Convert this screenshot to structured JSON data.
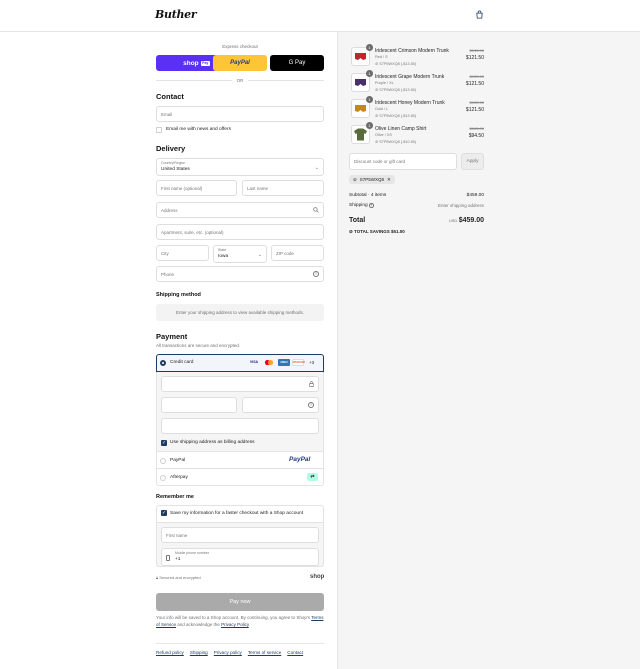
{
  "brand": {
    "logo": "Buther"
  },
  "express": {
    "title": "Express checkout",
    "or": "OR",
    "shop_pay": "shop",
    "shop_pay_tag": "Pay",
    "paypal": "PayPal",
    "gpay": "G Pay"
  },
  "contact": {
    "title": "Contact",
    "email_placeholder": "Email",
    "news_label": "Email me with news and offers"
  },
  "delivery": {
    "title": "Delivery",
    "country_label": "Country/Region",
    "country_value": "United States",
    "first_name": "First name (optional)",
    "last_name": "Last name",
    "address": "Address",
    "apartment": "Apartment, suite, etc. (optional)",
    "city": "City",
    "state_label": "State",
    "state_value": "Iowa",
    "zip": "ZIP code",
    "phone": "Phone"
  },
  "shipping": {
    "title": "Shipping method",
    "notice": "Enter your shipping address to view available shipping methods."
  },
  "payment": {
    "title": "Payment",
    "subtitle": "All transactions are secure and encrypted.",
    "credit_card": "Credit card",
    "more_cards": "+3",
    "billing_label": "Use shipping address as billing address",
    "paypal": "PayPal",
    "paypal_logo": "PayPal",
    "afterpay": "Afterpay",
    "card_logos": [
      "VISA",
      "MC",
      "AMEX",
      "DISCOVER"
    ]
  },
  "remember": {
    "title": "Remember me",
    "save_label": "Save my information for a faster checkout with a Shop account",
    "first_name": "First name",
    "mobile_label": "Mobile phone number",
    "mobile_value": "+1",
    "secure": "Secured and encrypted",
    "shop": "shop"
  },
  "pay_button": "Pay now",
  "disclaimer": {
    "text": "Your info will be saved to a Shop account. By continuing, you agree to Shop's",
    "tos": "Terms of Service",
    "and": "and acknowledge the",
    "privacy": "Privacy Policy",
    "period": "."
  },
  "footer_links": [
    "Refund policy",
    "Shipping",
    "Privacy policy",
    "Terms of service",
    "Contact"
  ],
  "items": [
    {
      "qty": "1",
      "name": "Iridescent Crimson Modern Trunk",
      "variant": "Red / S",
      "discount": "S7P5WXQ8 (-$13.50)",
      "old": "$135.00",
      "price": "$121.50",
      "color": "#c0262b"
    },
    {
      "qty": "1",
      "name": "Iridescent Grape Modern Trunk",
      "variant": "Purple / XL",
      "discount": "S7P5WXQ8 (-$13.50)",
      "old": "$135.00",
      "price": "$121.50",
      "color": "#4b2f6b"
    },
    {
      "qty": "1",
      "name": "Iridescent Honey Modern Trunk",
      "variant": "Gold / L",
      "discount": "S7P5WXQ8 (-$13.50)",
      "old": "$135.00",
      "price": "$121.50",
      "color": "#c28a1e"
    },
    {
      "qty": "1",
      "name": "Olive Linen Camp Shirt",
      "variant": "Olive / XS",
      "discount": "S7P5WXQ8 (-$10.50)",
      "old": "$105.00",
      "price": "$94.50",
      "color": "#5a6b3a"
    }
  ],
  "discount": {
    "placeholder": "Discount code or gift card",
    "apply": "Apply",
    "tag": "S7P5WXQ8"
  },
  "summary": {
    "subtotal_label": "Subtotal · 4 items",
    "subtotal": "$459.00",
    "shipping_label": "Shipping",
    "shipping_value": "Enter shipping address",
    "total_label": "Total",
    "currency": "USD",
    "total": "$459.00",
    "savings_label": "TOTAL SAVINGS",
    "savings": "$51.00"
  },
  "colors": {
    "accent": "#1f3b63",
    "shop_pay": "#5a31f4",
    "paypal_yellow": "#ffc439"
  }
}
